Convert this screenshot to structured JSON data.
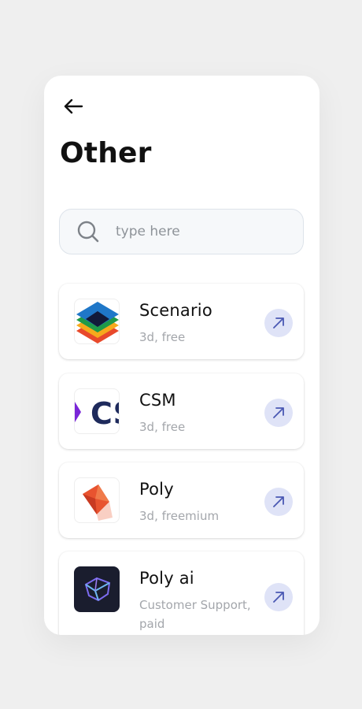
{
  "page": {
    "title": "Other"
  },
  "search": {
    "placeholder": "type here",
    "value": ""
  },
  "items": [
    {
      "name": "Scenario",
      "meta": "3d, free",
      "logo": "scenario-logo"
    },
    {
      "name": "CSM",
      "meta": "3d, free",
      "logo": "csm-logo"
    },
    {
      "name": "Poly",
      "meta": "3d, freemium",
      "logo": "poly-logo"
    },
    {
      "name": "Poly ai",
      "meta": "Customer Support, paid",
      "logo": "poly-ai-logo"
    }
  ],
  "icons": {
    "back": "arrow-left-icon",
    "search": "search-icon",
    "open": "arrow-up-right-icon"
  },
  "colors": {
    "background": "#efefef",
    "card": "#ffffff",
    "accent_circle": "#dfe3f7",
    "accent_arrow": "#4a58b3",
    "muted_text": "#a3a6ab"
  }
}
